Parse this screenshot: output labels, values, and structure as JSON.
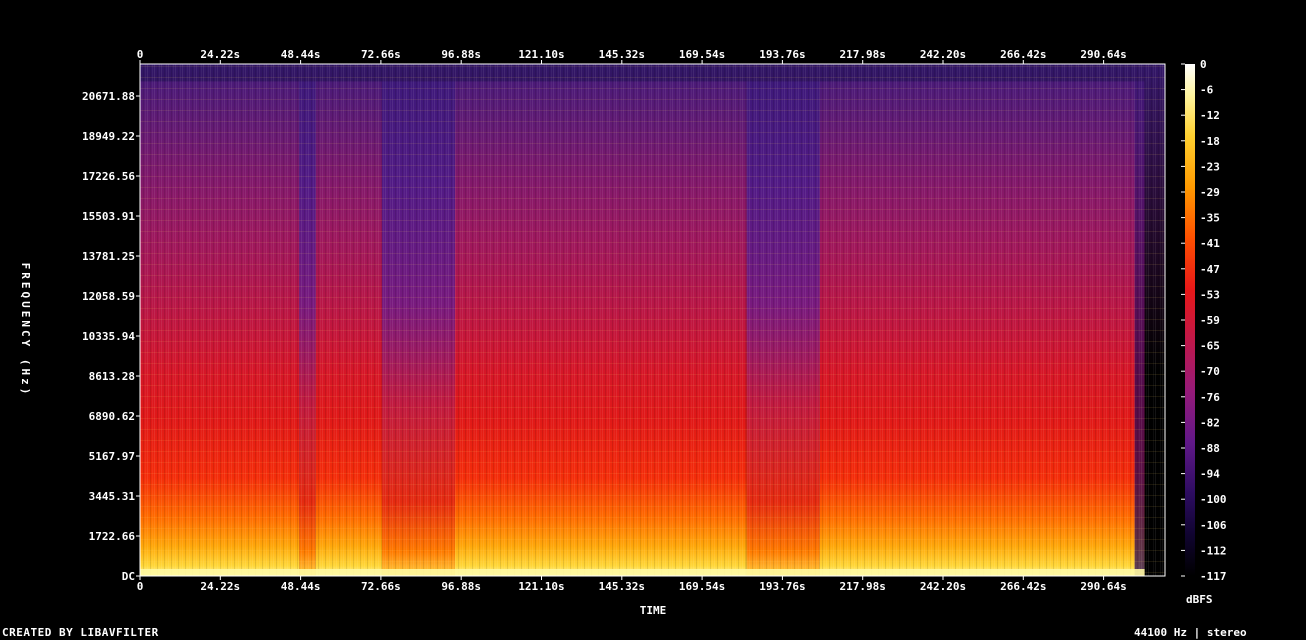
{
  "chart_data": {
    "type": "heatmap",
    "title": "",
    "xlabel": "TIME",
    "ylabel": "FREQUENCY (Hz)",
    "x_unit": "s",
    "x_ticks": [
      "0",
      "24.22s",
      "48.44s",
      "72.66s",
      "96.88s",
      "121.10s",
      "145.32s",
      "169.54s",
      "193.76s",
      "217.98s",
      "242.20s",
      "266.42s",
      "290.64s"
    ],
    "y_ticks": [
      "DC",
      "1722.66",
      "3445.31",
      "5167.97",
      "6890.62",
      "8613.28",
      "10335.94",
      "12058.59",
      "13781.25",
      "15503.91",
      "17226.56",
      "18949.22",
      "20671.88"
    ],
    "xlim": [
      0,
      306
    ],
    "ylim": [
      0,
      22050
    ],
    "colorbar": {
      "label": "dBFS",
      "ticks": [
        "0",
        "-6",
        "-12",
        "-18",
        "-23",
        "-29",
        "-35",
        "-41",
        "-47",
        "-53",
        "-59",
        "-65",
        "-70",
        "-76",
        "-82",
        "-88",
        "-94",
        "-100",
        "-106",
        "-112",
        "-117"
      ],
      "range": [
        -120,
        0
      ],
      "colors": [
        "#000000",
        "#1a0640",
        "#4a1785",
        "#8a1b8c",
        "#c41860",
        "#e8161c",
        "#ff3a00",
        "#ff8c00",
        "#ffc820",
        "#fff090",
        "#ffffff"
      ]
    },
    "loud_segments_s": [
      [
        0,
        48
      ],
      [
        53,
        73
      ],
      [
        95,
        183
      ],
      [
        205,
        303
      ]
    ],
    "quiet_segments_s": [
      [
        48,
        53
      ],
      [
        73,
        95
      ],
      [
        183,
        205
      ]
    ]
  },
  "footer": {
    "credit": "CREATED BY LIBAVFILTER",
    "info": "44100 Hz | stereo"
  },
  "colors": {
    "background": "#000000",
    "axis": "#ffffff",
    "text": "#ffffff"
  }
}
